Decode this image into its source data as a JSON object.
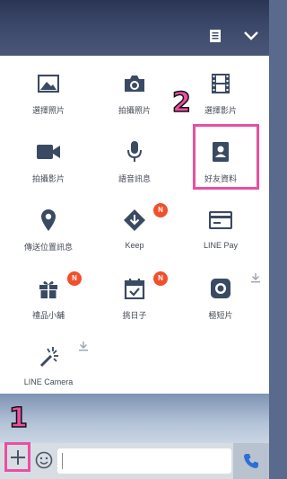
{
  "grid": {
    "items": [
      {
        "label": "選擇照片",
        "icon": "photo-icon"
      },
      {
        "label": "拍攝照片",
        "icon": "camera-icon"
      },
      {
        "label": "選擇影片",
        "icon": "film-icon"
      },
      {
        "label": "拍攝影片",
        "icon": "video-camera-icon"
      },
      {
        "label": "語音訊息",
        "icon": "microphone-icon"
      },
      {
        "label": "好友資料",
        "icon": "contact-card-icon"
      },
      {
        "label": "傳送位置訊息",
        "icon": "location-pin-icon"
      },
      {
        "label": "Keep",
        "icon": "keep-icon",
        "badge": "N"
      },
      {
        "label": "LINE Pay",
        "icon": "card-icon"
      },
      {
        "label": "禮品小舖",
        "icon": "gift-icon",
        "badge": "N"
      },
      {
        "label": "挑日子",
        "icon": "calendar-check-icon",
        "badge": "N"
      },
      {
        "label": "極短片",
        "icon": "record-icon",
        "download": true
      },
      {
        "label": "LINE Camera",
        "icon": "magic-wand-icon",
        "download": true
      }
    ]
  },
  "annotations": {
    "step1": "1",
    "step2": "2"
  },
  "colors": {
    "icon": "#3b4a63",
    "badge": "#f0502b",
    "highlight": "#e94fa2",
    "send": "#2d6fd6"
  }
}
